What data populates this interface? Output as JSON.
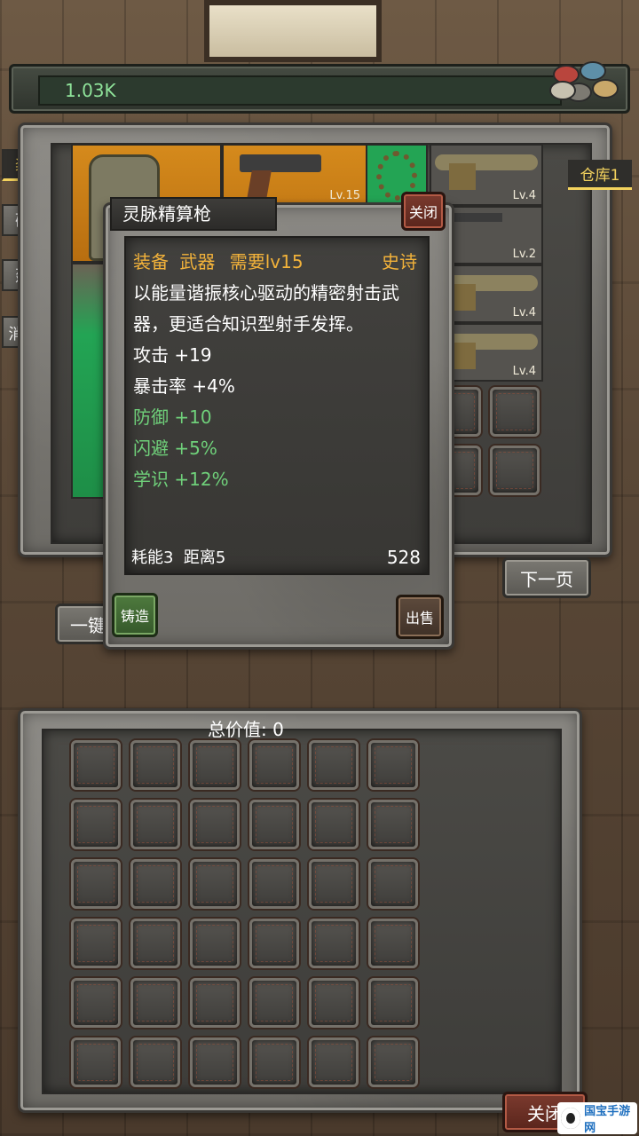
{
  "header": {
    "currency_value": "1.03K"
  },
  "tabs": [
    {
      "label": "装备",
      "active": true
    },
    {
      "label": "矿石"
    },
    {
      "label": "建材"
    },
    {
      "label": "消耗品"
    }
  ],
  "warehouse_tab": "仓库1",
  "inventory": {
    "items": [
      {
        "name": "tactical-backpack",
        "level": ""
      },
      {
        "name": "pistol",
        "level": "Lv.15"
      },
      {
        "name": "bead-necklace",
        "level": ""
      },
      {
        "name": "utility-belt",
        "level": "Lv.4"
      },
      {
        "name": "rifle",
        "level": "Lv.2"
      },
      {
        "name": "utility-belt",
        "level": "Lv.4"
      },
      {
        "name": "utility-belt",
        "level": "Lv.4"
      }
    ],
    "next_page_label": "下一页",
    "partial_button_label": "一键"
  },
  "popup": {
    "title": "灵脉精算枪",
    "close_label": "关闭",
    "category": "装备",
    "type": "武器",
    "requirement": "需要lv15",
    "rarity": "史诗",
    "description": "以能量谐振核心驱动的精密射击武器，更适合知识型射手发挥。",
    "stats": [
      {
        "text": "攻击 +19",
        "color": "white"
      },
      {
        "text": "暴击率 +4%",
        "color": "white"
      },
      {
        "text": "防御 +10",
        "color": "green"
      },
      {
        "text": "闪避 +5%",
        "color": "green"
      },
      {
        "text": "学识 +12%",
        "color": "green"
      }
    ],
    "footer_left": "耗能3  距离5",
    "footer_price": "528",
    "forge_label": "铸造",
    "sell_label": "出售"
  },
  "sell_panel": {
    "total_label": "总价值: 0",
    "slot_count": 36,
    "close_label": "关闭"
  },
  "colors": {
    "gold": "#f2b23a",
    "green": "#6fd07a",
    "active_tab": "#f4d35e",
    "currency_text": "#8fe39a"
  },
  "watermark": {
    "label": "国宝手游网"
  }
}
